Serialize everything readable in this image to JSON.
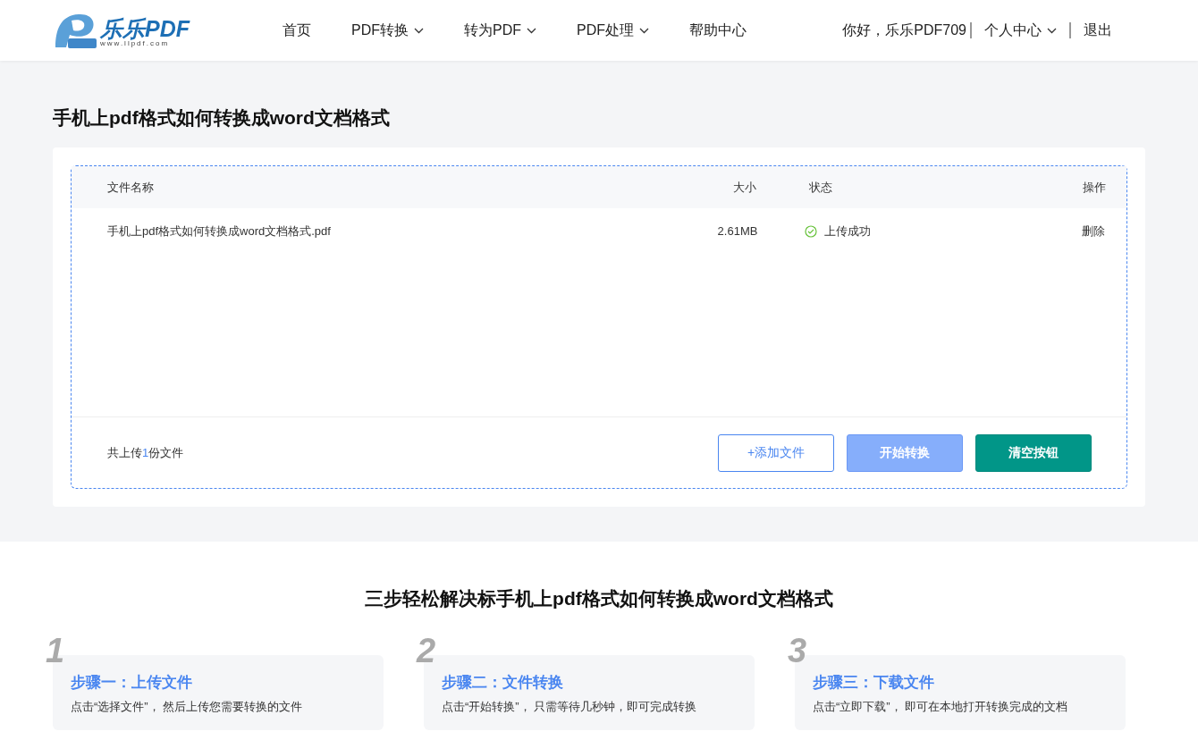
{
  "logo": {
    "name": "乐乐PDF",
    "url": "www.llpdf.com"
  },
  "nav": [
    {
      "label": "首页",
      "dropdown": false
    },
    {
      "label": "PDF转换",
      "dropdown": true
    },
    {
      "label": "转为PDF",
      "dropdown": true
    },
    {
      "label": "PDF处理",
      "dropdown": true
    },
    {
      "label": "帮助中心",
      "dropdown": false
    }
  ],
  "user": {
    "greeting": "你好，乐乐PDF709",
    "center": "个人中心",
    "logout": "退出"
  },
  "page_title": "手机上pdf格式如何转换成word文档格式",
  "table": {
    "columns": [
      "文件名称",
      "大小",
      "状态",
      "操作"
    ],
    "rows": [
      {
        "name": "手机上pdf格式如何转换成word文档格式.pdf",
        "size": "2.61MB",
        "status": "上传成功",
        "action": "删除"
      }
    ]
  },
  "summary": {
    "prefix": "共上传",
    "count": "1",
    "suffix": "份文件"
  },
  "buttons": [
    {
      "label": "+添加文件",
      "kind": "outline"
    },
    {
      "label": "开始转换",
      "kind": "light"
    },
    {
      "label": "清空按钮",
      "kind": "primary"
    }
  ],
  "steps_title": "三步轻松解决标手机上pdf格式如何转换成word文档格式",
  "steps": [
    {
      "number": "1",
      "title": "步骤一：上传文件",
      "text": "点击“选择文件”， 然后上传您需要转换的文件"
    },
    {
      "number": "2",
      "title": "步骤二：文件转换",
      "text": "点击“开始转换”， 只需等待几秒钟，即可完成转换"
    },
    {
      "number": "3",
      "title": "步骤三：下载文件",
      "text": "点击“立即下载”， 即可在本地打开转换完成的文档"
    }
  ]
}
